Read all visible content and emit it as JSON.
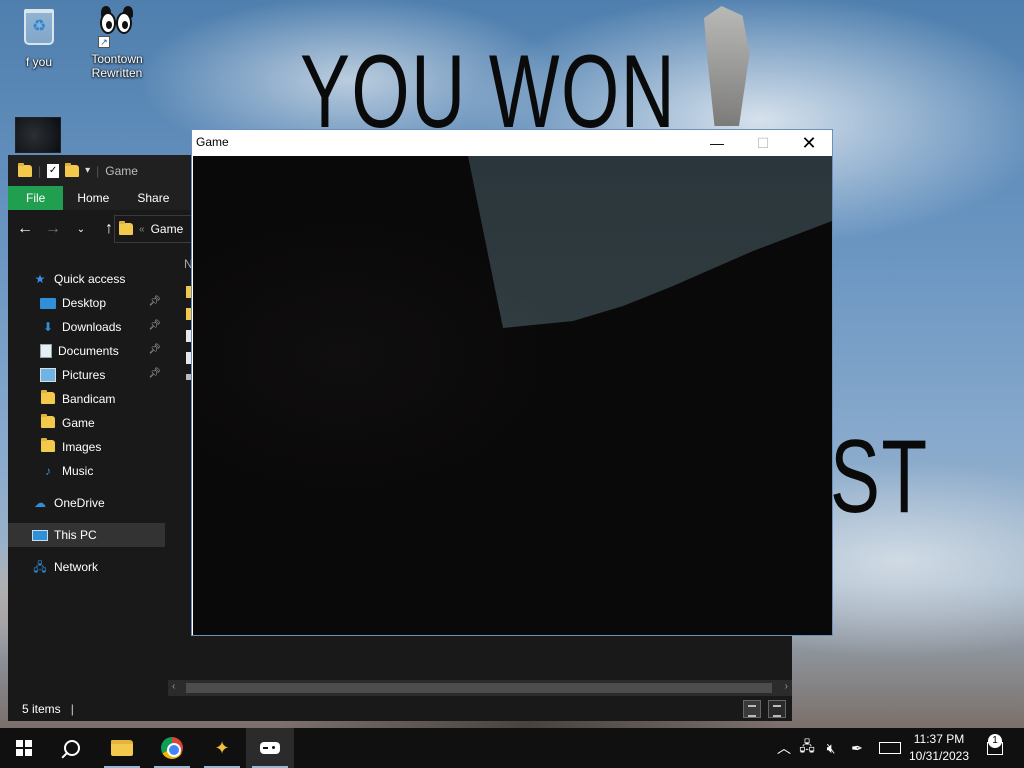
{
  "desktop": {
    "wallpaper_text_top": "YOU WON",
    "wallpaper_text_bottom": "ST",
    "icons": [
      {
        "label": "f you",
        "icon": "recycle-bin-icon"
      },
      {
        "label": "Toontown Rewritten",
        "icon": "toontown-icon"
      }
    ]
  },
  "explorer": {
    "title": "Game",
    "ribbon_tabs": [
      "File",
      "Home",
      "Share"
    ],
    "address_crumb": "Game",
    "column_header_partial": "N",
    "nav_items": [
      {
        "label": "Quick access",
        "icon": "star-icon"
      },
      {
        "label": "Desktop",
        "icon": "desktop-icon",
        "pinned": true
      },
      {
        "label": "Downloads",
        "icon": "download-icon",
        "pinned": true
      },
      {
        "label": "Documents",
        "icon": "document-icon",
        "pinned": true
      },
      {
        "label": "Pictures",
        "icon": "pictures-icon",
        "pinned": true
      },
      {
        "label": "Bandicam",
        "icon": "folder-icon"
      },
      {
        "label": "Game",
        "icon": "folder-icon"
      },
      {
        "label": "Images",
        "icon": "folder-icon"
      },
      {
        "label": "Music",
        "icon": "music-icon"
      },
      {
        "label": "OneDrive",
        "icon": "cloud-icon"
      },
      {
        "label": "This PC",
        "icon": "computer-icon",
        "selected": true
      },
      {
        "label": "Network",
        "icon": "network-icon"
      }
    ],
    "status_items": "5 items",
    "colors": {
      "file_tab": "#1f9f4f",
      "background": "#191919"
    }
  },
  "game_window": {
    "title": "Game",
    "close_glyph": "✕",
    "minimize_glyph": "—",
    "maximize_glyph": "☐"
  },
  "taskbar": {
    "apps": [
      "start-icon",
      "search-icon",
      "file-explorer-icon",
      "chrome-icon",
      "toontown-icon",
      "game-icon"
    ],
    "time": "11:37 PM",
    "date": "10/31/2023",
    "notification_count": "1"
  }
}
